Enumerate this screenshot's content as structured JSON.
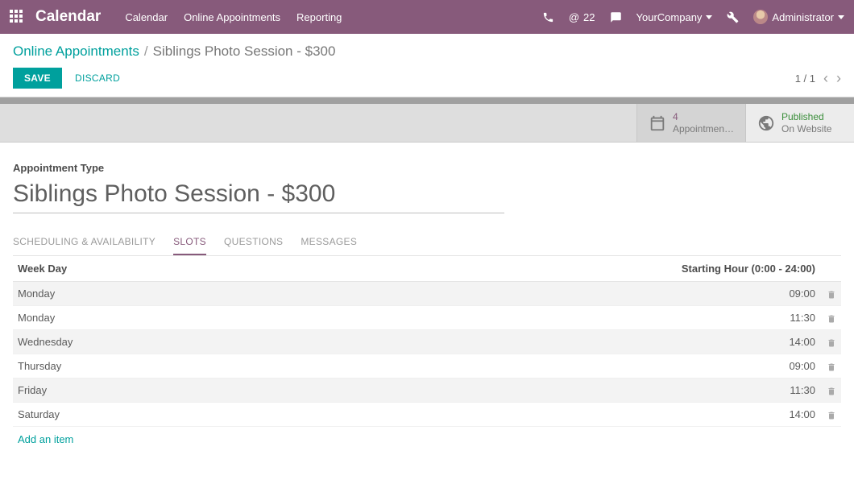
{
  "brand": "Calendar",
  "nav": [
    "Calendar",
    "Online Appointments",
    "Reporting"
  ],
  "mail_count": "22",
  "company": "YourCompany",
  "user": "Administrator",
  "breadcrumb": {
    "parent": "Online Appointments",
    "current": "Siblings Photo Session - $300"
  },
  "buttons": {
    "save": "SAVE",
    "discard": "DISCARD"
  },
  "pager": {
    "pos": "1 / 1"
  },
  "statusbar": {
    "appt_count": "4",
    "appt_label": "Appointmen…",
    "pub_label": "Published",
    "pub_sub": "On Website"
  },
  "form": {
    "field_label": "Appointment Type",
    "title": "Siblings Photo Session - $300"
  },
  "tabs": [
    "SCHEDULING & AVAILABILITY",
    "SLOTS",
    "QUESTIONS",
    "MESSAGES"
  ],
  "active_tab": 1,
  "table": {
    "col_day": "Week Day",
    "col_hour": "Starting Hour (0:00 - 24:00)",
    "rows": [
      {
        "day": "Monday",
        "hour": "09:00"
      },
      {
        "day": "Monday",
        "hour": "11:30"
      },
      {
        "day": "Wednesday",
        "hour": "14:00"
      },
      {
        "day": "Thursday",
        "hour": "09:00"
      },
      {
        "day": "Friday",
        "hour": "11:30"
      },
      {
        "day": "Saturday",
        "hour": "14:00"
      }
    ],
    "add_item": "Add an item"
  }
}
